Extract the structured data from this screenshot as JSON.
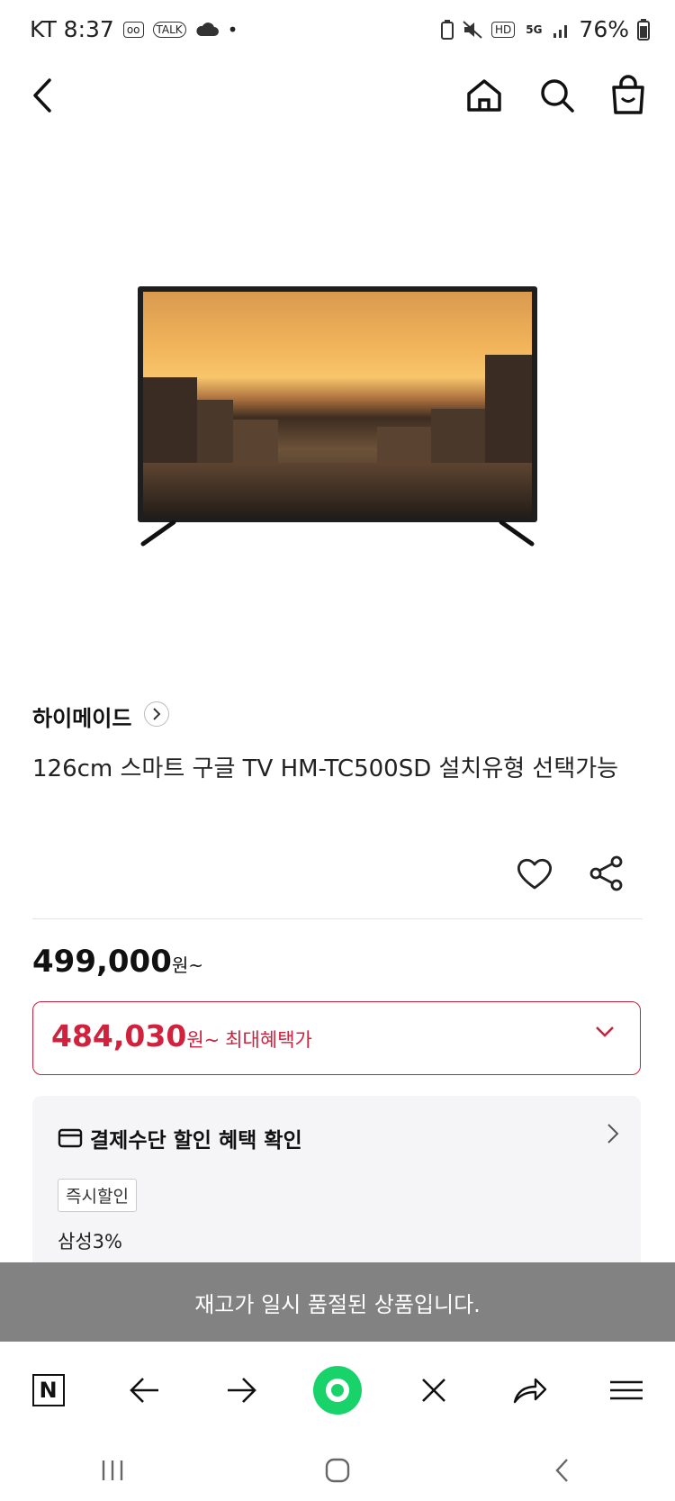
{
  "status_bar": {
    "carrier_time": "KT 8:37",
    "talk": "TALK",
    "hd": "HD",
    "network": "5G",
    "battery": "76%"
  },
  "header": {
    "back_icon": "back-arrow-icon",
    "home_icon": "home-icon",
    "search_icon": "search-icon",
    "cart_icon": "shopping-bag-icon"
  },
  "product": {
    "brand": "하이메이드",
    "title": "126cm 스마트 구글 TV HM-TC500SD 설치유형 선택가능",
    "price": "499,000",
    "price_unit": "원~",
    "benefit_price": "484,030",
    "benefit_unit": "원~",
    "benefit_label": "최대혜택가"
  },
  "payment_card": {
    "title": "결제수단 할인 혜택 확인",
    "tag": "즉시할인",
    "detail": "삼성3%"
  },
  "toast": "재고가 일시 품절된 상품입니다.",
  "browser_bar": {
    "n_label": "N"
  },
  "colors": {
    "accent": "#d0213d",
    "browser_green": "#18d36a"
  }
}
